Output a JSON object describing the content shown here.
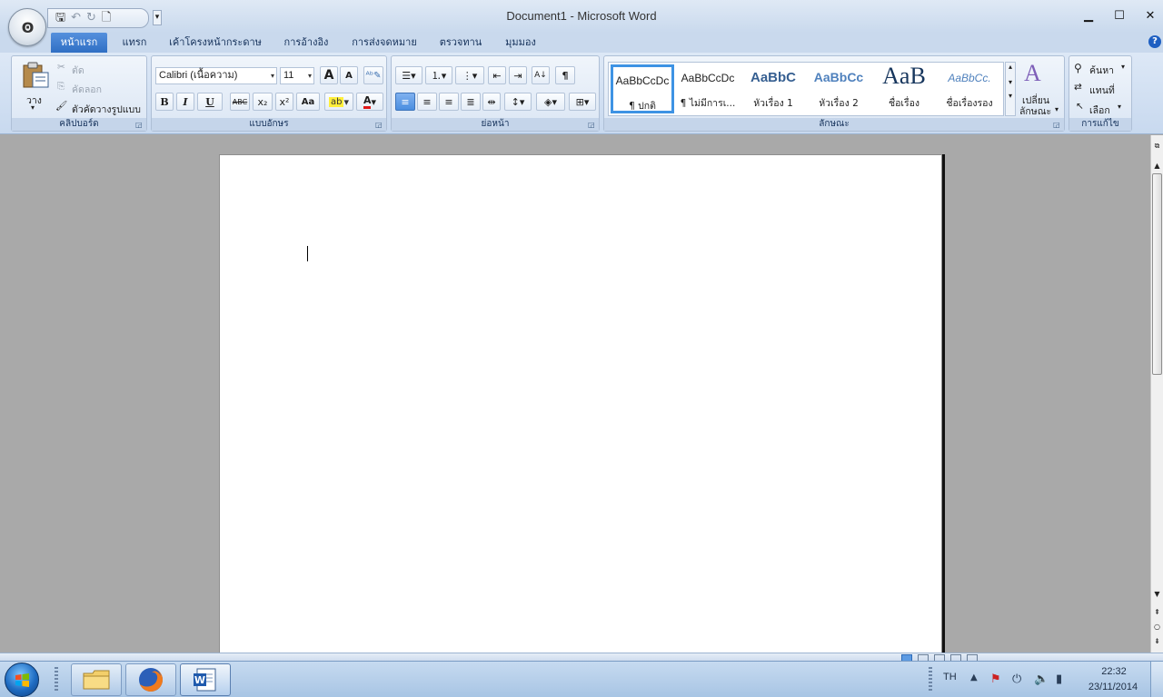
{
  "window": {
    "title": "Document1 - Microsoft Word",
    "office_logo": "Ꙩ",
    "controls": {
      "minimize": "▁",
      "maximize": "☐",
      "close": "✕"
    }
  },
  "quick_access": {
    "save_icon": "save-icon",
    "undo_icon": "undo-icon",
    "redo_icon": "redo-icon",
    "new_icon": "new-document-icon"
  },
  "tabs": [
    {
      "label": "หน้าแรก",
      "active": true
    },
    {
      "label": "แทรก"
    },
    {
      "label": "เค้าโครงหน้ากระดาษ"
    },
    {
      "label": "การอ้างอิง"
    },
    {
      "label": "การส่งจดหมาย"
    },
    {
      "label": "ตรวจทาน"
    },
    {
      "label": "มุมมอง"
    }
  ],
  "ribbon": {
    "clipboard": {
      "label": "คลิปบอร์ด",
      "paste": "วาง",
      "cut": "ตัด",
      "copy": "คัดลอก",
      "format_painter": "ตัวคัดวางรูปแบบ"
    },
    "font": {
      "label": "แบบอักษร",
      "font_name": "Calibri (เนื้อความ)",
      "font_size": "11",
      "bold": "B",
      "italic": "I",
      "underline": "U",
      "strikethrough": "ABC",
      "subscript": "x₂",
      "superscript": "x²",
      "change_case": "Aa",
      "grow": "A",
      "shrink": "A",
      "font_color": "A"
    },
    "paragraph": {
      "label": "ย่อหน้า",
      "pilcrow": "¶"
    },
    "styles": {
      "label": "ลักษณะ",
      "items": [
        {
          "sample": "AaBbCcDc",
          "name": "¶ ปกติ"
        },
        {
          "sample": "AaBbCcDc",
          "name": "¶ ไม่มีการเ..."
        },
        {
          "sample": "AaBbC",
          "name": "หัวเรื่อง 1"
        },
        {
          "sample": "AaBbCc",
          "name": "หัวเรื่อง 2"
        },
        {
          "sample": "AaB",
          "name": "ชื่อเรื่อง"
        },
        {
          "sample": "AaBbCc.",
          "name": "ชื่อเรื่องรอง"
        }
      ],
      "change_styles_line1": "เปลี่ยน",
      "change_styles_line2": "ลักษณะ"
    },
    "editing": {
      "label": "การแก้ไข",
      "find": "ค้นหา",
      "replace": "แทนที่",
      "select": "เลือก"
    }
  },
  "taskbar": {
    "language": "TH",
    "time": "22:32",
    "date": "23/11/2014"
  }
}
